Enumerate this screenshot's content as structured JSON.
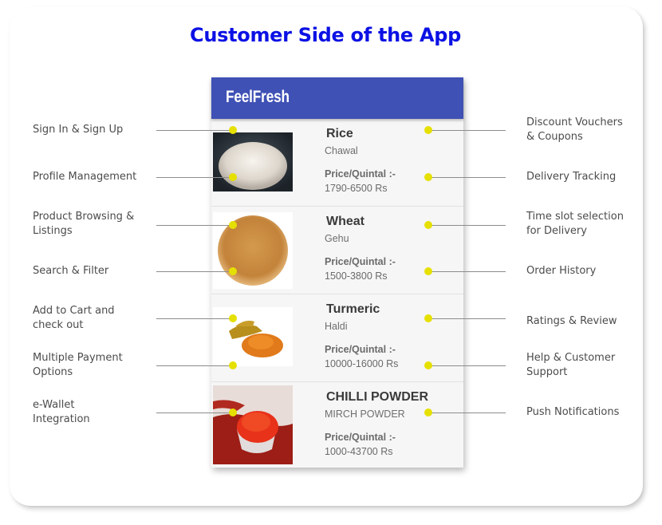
{
  "title": "Customer Side of the App",
  "app": {
    "brand": "FeelFresh",
    "accent_color": "#3f51b5",
    "products": [
      {
        "name": "Rice",
        "local_name": "Chawal",
        "price_label": "Price/Quintal :-",
        "price": "1790-6500 Rs",
        "image": "rice-image"
      },
      {
        "name": "Wheat",
        "local_name": "Gehu",
        "price_label": "Price/Quintal :-",
        "price": "1500-3800 Rs",
        "image": "wheat-image"
      },
      {
        "name": "Turmeric",
        "local_name": "Haldi",
        "price_label": "Price/Quintal :-",
        "price": "10000-16000 Rs",
        "image": "turmeric-image"
      },
      {
        "name": "CHILLI POWDER",
        "local_name": "MIRCH POWDER",
        "price_label": "Price/Quintal :-",
        "price": "1000-43700 Rs",
        "image": "chilli-powder-image"
      }
    ]
  },
  "features_left": [
    {
      "line1": "Sign In & Sign Up",
      "line2": ""
    },
    {
      "line1": "Profile Management",
      "line2": ""
    },
    {
      "line1": "Product Browsing &",
      "line2": "Listings"
    },
    {
      "line1": "Search & Filter",
      "line2": ""
    },
    {
      "line1": "Add to Cart and",
      "line2": "check out"
    },
    {
      "line1": "Multiple Payment",
      "line2": "Options"
    },
    {
      "line1": "e-Wallet",
      "line2": "Integration"
    }
  ],
  "features_right": [
    {
      "line1": "Discount Vouchers",
      "line2": "& Coupons"
    },
    {
      "line1": "Delivery Tracking",
      "line2": ""
    },
    {
      "line1": "Time slot selection",
      "line2": "for Delivery"
    },
    {
      "line1": "Order History",
      "line2": ""
    },
    {
      "line1": "Ratings & Review",
      "line2": ""
    },
    {
      "line1": "Help & Customer",
      "line2": "Support"
    },
    {
      "line1": "Push Notifications",
      "line2": ""
    }
  ],
  "colors": {
    "title": "#0b11e4",
    "marker_dot": "#e6e000",
    "connector_line": "#8c8c8c"
  }
}
